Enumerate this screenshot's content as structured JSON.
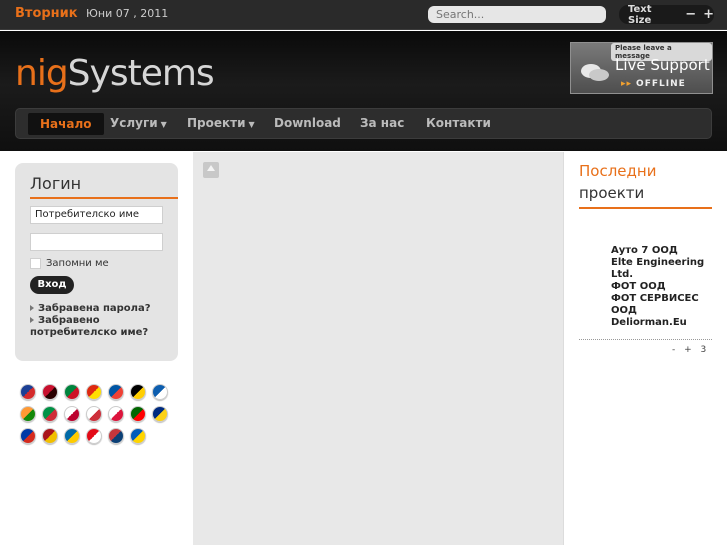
{
  "topbar": {
    "day": "Вторник",
    "date": "Юни 07 , 2011",
    "search_placeholder": "Search...",
    "text_size_label": "Text Size",
    "minus": "−",
    "plus": "+"
  },
  "header": {
    "logo_part1": "nig",
    "logo_part2": "Systems",
    "support_tag": "Please leave a message",
    "support_title": "Live Support",
    "support_status": "OFFLINE"
  },
  "nav": {
    "items": [
      {
        "label": "Начало"
      },
      {
        "label": "Услуги"
      },
      {
        "label": "Проекти"
      },
      {
        "label": "Download"
      },
      {
        "label": "За нас"
      },
      {
        "label": "Контакти"
      }
    ]
  },
  "login": {
    "title": "Логин",
    "username_value": "Потребителско име",
    "password_value": "",
    "remember_label": "Запомни ме",
    "button_label": "Вход",
    "forgot_password": "Забравена парола?",
    "forgot_username_line1": "Забравено",
    "forgot_username_line2": "потребителско име?"
  },
  "flags": [
    {
      "name": "english-flag",
      "c1": "#1c3f94",
      "c2": "#d42a2a"
    },
    {
      "name": "albanian-flag",
      "c1": "#c8102e",
      "c2": "#2a0000"
    },
    {
      "name": "arabic-flag",
      "c1": "#00843d",
      "c2": "#ce1126"
    },
    {
      "name": "chinese-flag",
      "c1": "#de2910",
      "c2": "#ffde00"
    },
    {
      "name": "french-flag",
      "c1": "#0055a4",
      "c2": "#ef4135"
    },
    {
      "name": "german-flag",
      "c1": "#000000",
      "c2": "#ffce00"
    },
    {
      "name": "greek-flag",
      "c1": "#0d5eaf",
      "c2": "#ffffff"
    },
    {
      "name": "hindi-flag",
      "c1": "#ff9933",
      "c2": "#138808"
    },
    {
      "name": "italian-flag",
      "c1": "#009246",
      "c2": "#ce2b37"
    },
    {
      "name": "japanese-flag",
      "c1": "#ffffff",
      "c2": "#bc002d"
    },
    {
      "name": "korean-flag",
      "c1": "#ffffff",
      "c2": "#cd2e3a"
    },
    {
      "name": "polish-flag",
      "c1": "#ffffff",
      "c2": "#dc143c"
    },
    {
      "name": "portuguese-flag",
      "c1": "#006600",
      "c2": "#ff0000"
    },
    {
      "name": "romanian-flag",
      "c1": "#002b7f",
      "c2": "#fcd116"
    },
    {
      "name": "russian-flag",
      "c1": "#0039a6",
      "c2": "#d52b1e"
    },
    {
      "name": "spanish-flag",
      "c1": "#aa151b",
      "c2": "#f1bf00"
    },
    {
      "name": "swedish-flag",
      "c1": "#006aa7",
      "c2": "#fecc00"
    },
    {
      "name": "turkish-flag",
      "c1": "#e30a17",
      "c2": "#ffffff"
    },
    {
      "name": "serbian-flag",
      "c1": "#c6363c",
      "c2": "#0c4076"
    },
    {
      "name": "ukrainian-flag",
      "c1": "#005bbb",
      "c2": "#ffd500"
    }
  ],
  "right": {
    "title_line1": "Последни",
    "title_line2": "проекти",
    "projects": [
      "Ауто 7 ООД",
      "Elte Engineering Ltd.",
      "ФОТ ООД",
      "ФОТ СЕРВИСЕС ООД",
      "Deliorman.Eu"
    ],
    "pager": [
      "-",
      "+",
      "3"
    ]
  },
  "colors": {
    "accent": "#e8701a",
    "dark": "#1b1b1b"
  }
}
